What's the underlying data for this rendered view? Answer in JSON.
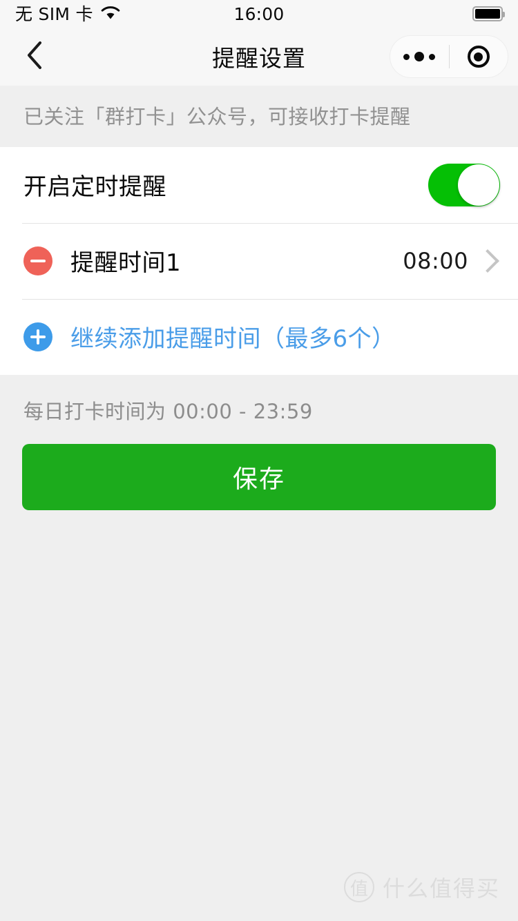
{
  "status_bar": {
    "carrier": "无 SIM 卡",
    "wifi_icon": "wifi-icon",
    "time": "16:00",
    "battery_icon": "battery-full-icon"
  },
  "nav_bar": {
    "back_icon": "chevron-left-icon",
    "title": "提醒设置",
    "capsule": {
      "more_icon": "more-dots-icon",
      "target_icon": "target-circle-icon"
    }
  },
  "notice": {
    "text": "已关注「群打卡」公众号，可接收打卡提醒"
  },
  "settings": {
    "enable_row": {
      "label": "开启定时提醒",
      "toggle_on": true,
      "toggle_color": "#05BF05"
    },
    "reminders": [
      {
        "delete_icon": "minus-circle-icon",
        "delete_color": "#EF6258",
        "label": "提醒时间1",
        "value": "08:00",
        "chevron_icon": "chevron-right-icon"
      }
    ],
    "add_row": {
      "add_icon": "plus-circle-icon",
      "add_color": "#3D9BE9",
      "label": "继续添加提醒时间（最多6个）",
      "text_color": "#4A9DE8"
    }
  },
  "footer": {
    "note": "每日打卡时间为 00:00 - 23:59",
    "save_label": "保存",
    "save_color": "#1CAB1C"
  },
  "watermark": {
    "logo_char": "值",
    "text": "什么值得买"
  }
}
